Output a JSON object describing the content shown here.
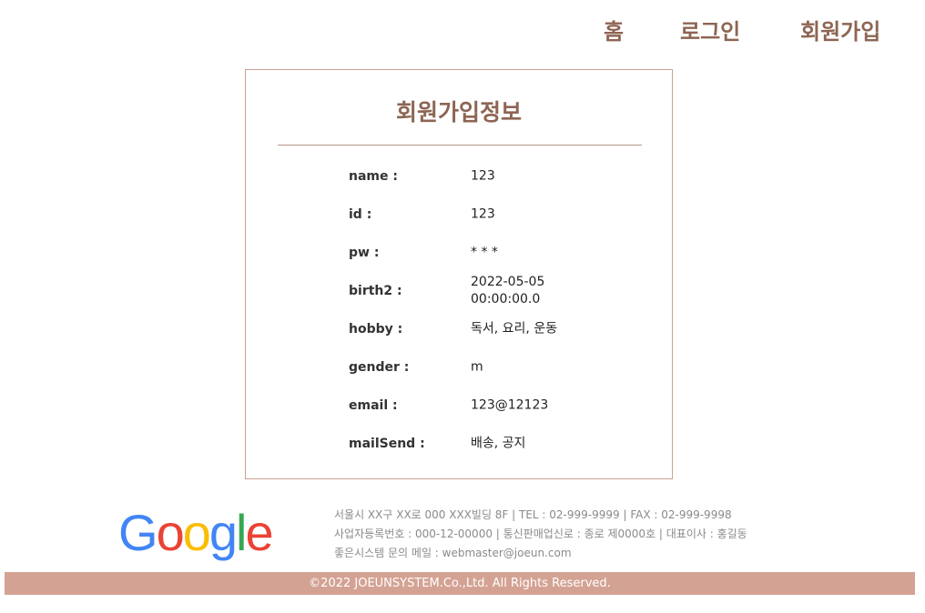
{
  "nav": {
    "home": "홈",
    "login": "로그인",
    "join": "회원가입"
  },
  "card": {
    "title": "회원가입정보",
    "fields": [
      {
        "label": "name :",
        "value": "123"
      },
      {
        "label": "id :",
        "value": "123"
      },
      {
        "label": "pw :",
        "value": "* * *"
      },
      {
        "label": "birth2 :",
        "value": "2022-05-05\n00:00:00.0"
      },
      {
        "label": "hobby :",
        "value": "독서, 요리, 운동"
      },
      {
        "label": "gender :",
        "value": "m"
      },
      {
        "label": "email :",
        "value": "123@12123"
      },
      {
        "label": "mailSend :",
        "value": "배송, 공지"
      }
    ]
  },
  "footer": {
    "logo_letters": [
      "G",
      "o",
      "o",
      "g",
      "l",
      "e"
    ],
    "logo_colors": [
      "#4285F4",
      "#EA4335",
      "#FBBC05",
      "#4285F4",
      "#34A853",
      "#EA4335"
    ],
    "address_line": "서울시 XX구 XX로 000 XXX빌딩 8F | TEL : 02-999-9999 | FAX : 02-999-9998",
    "business_line": "사업자등록번호 : 000-12-00000 | 통신판매업신로 : 종로 제0000호 | 대표이사 : 홍길동",
    "mail_line": "좋은시스템 문의 메일 : webmaster@joeun.com",
    "copyright": "©2022 JOEUNSYSTEM.Co.,Ltd. All Rights Reserved."
  },
  "colors": {
    "accent": "#8d6553",
    "card_border": "#c9a294",
    "footer_bar": "#d4a293"
  }
}
